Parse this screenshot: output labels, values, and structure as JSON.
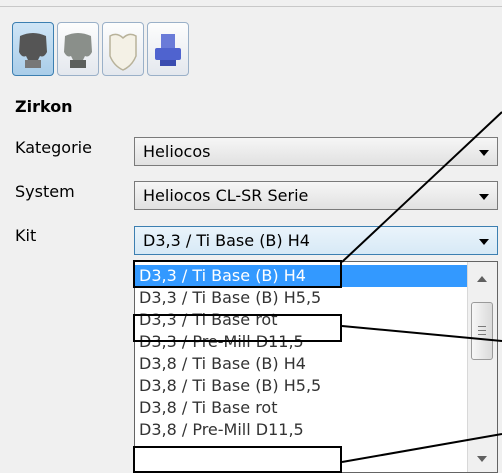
{
  "material_buttons": [
    {
      "icon": "dark-crown-icon",
      "active": true
    },
    {
      "icon": "metal-crown-icon",
      "active": false
    },
    {
      "icon": "white-crown-icon",
      "active": false
    },
    {
      "icon": "blue-abutment-icon",
      "active": false
    }
  ],
  "section_title": "Zirkon",
  "fields": {
    "kategorie": {
      "label": "Kategorie",
      "value": "Heliocos"
    },
    "system": {
      "label": "System",
      "value": "Heliocos CL-SR Serie"
    },
    "kit": {
      "label": "Kit",
      "value": "D3,3 / Ti Base (B) H4"
    }
  },
  "dropdown": {
    "items": [
      "D3,3 / Ti Base (B) H4",
      "D3,3 / Ti Base (B) H5,5",
      "D3,3 / Ti Base rot",
      "D3,3 / Pre-Mill D11,5",
      "D3,8 / Ti Base (B) H4",
      "D3,8 / Ti Base (B) H5,5",
      "D3,8 / Ti Base rot",
      "D3,8 / Pre-Mill D11,5"
    ],
    "selected_index": 0
  },
  "colors": {
    "selection": "#3399ff",
    "accent": "#3c7fb1"
  }
}
